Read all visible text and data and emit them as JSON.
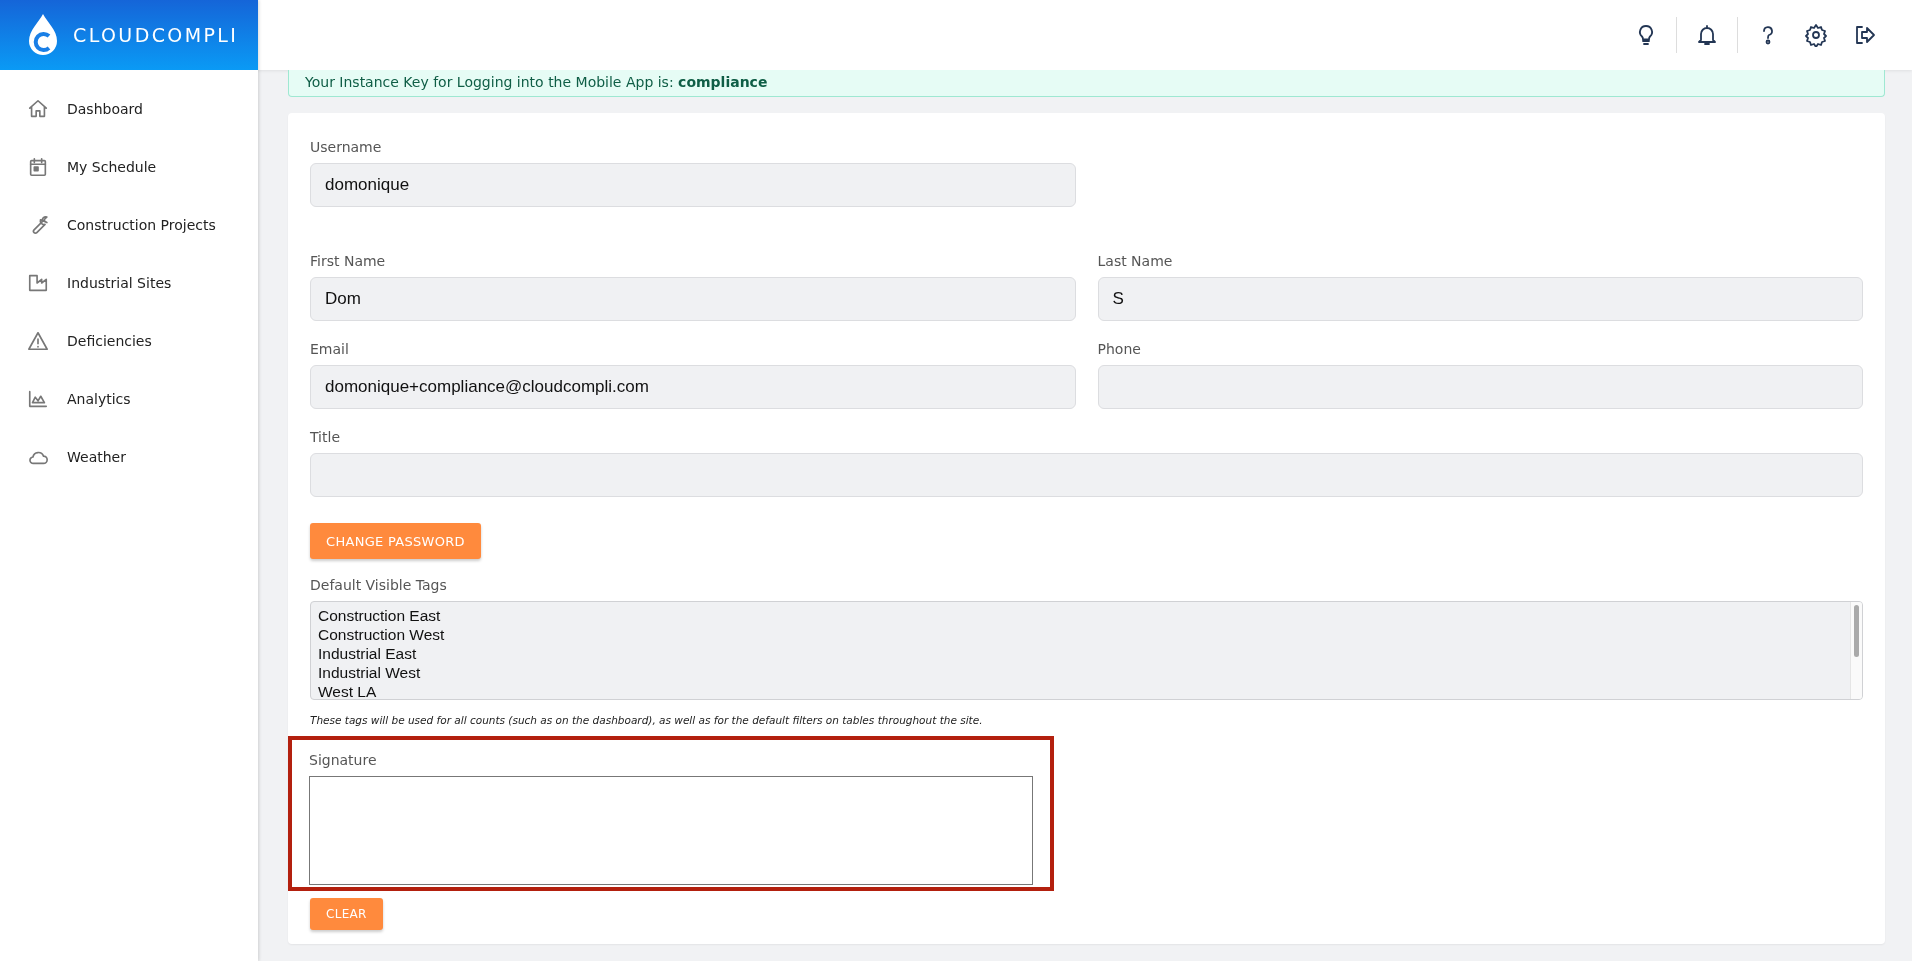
{
  "logo": {
    "text": "CLOUDCOMPLI"
  },
  "sidebar": {
    "items": [
      {
        "label": "Dashboard"
      },
      {
        "label": "My Schedule"
      },
      {
        "label": "Construction Projects"
      },
      {
        "label": "Industrial Sites"
      },
      {
        "label": "Deficiencies"
      },
      {
        "label": "Analytics"
      },
      {
        "label": "Weather"
      }
    ]
  },
  "banner": {
    "text": "Your Instance Key for Logging into the Mobile App is: **compliance**"
  },
  "form": {
    "username": {
      "label": "Username",
      "value": "domonique"
    },
    "first_name": {
      "label": "First Name",
      "value": "Dom"
    },
    "last_name": {
      "label": "Last Name",
      "value": "S"
    },
    "email": {
      "label": "Email",
      "value": "domonique+compliance@cloudcompli.com"
    },
    "phone": {
      "label": "Phone"
    },
    "title": {
      "label": "Title"
    },
    "change_password_button": "CHANGE PASSWORD",
    "tags": {
      "label": "Default Visible Tags",
      "options": [
        "Construction East",
        "Construction West",
        "Industrial East",
        "Industrial West",
        "West LA"
      ],
      "help": "These tags will be used for all counts (such as on the dashboard), as well as for the default filters on tables throughout the site."
    },
    "signature": {
      "label": "Signature"
    },
    "clear_button": "CLEAR"
  }
}
